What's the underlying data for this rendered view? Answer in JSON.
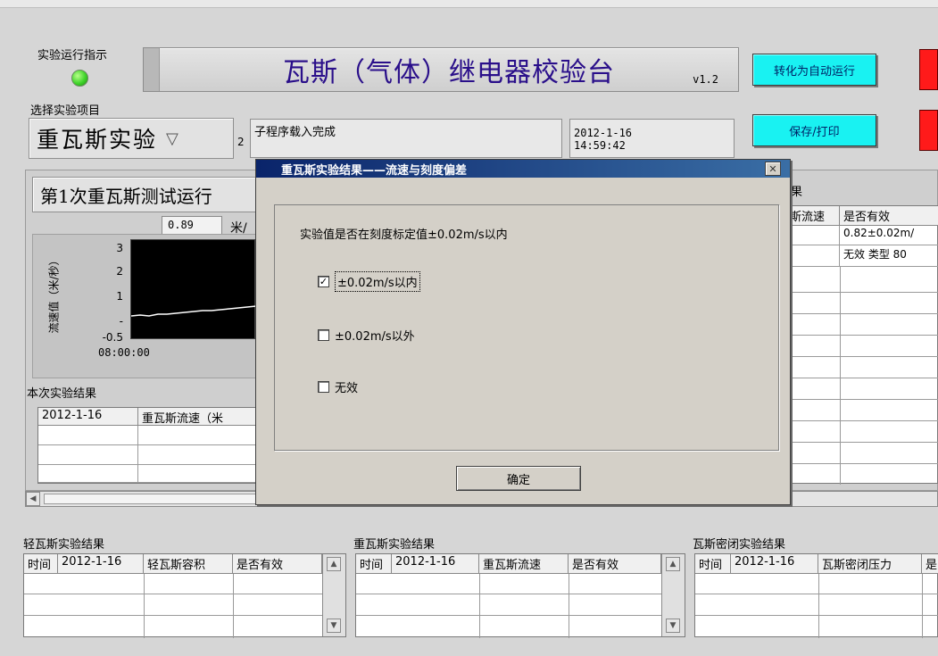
{
  "header": {
    "indicator_label": "实验运行指示",
    "title": "瓦斯（气体）继电器校验台",
    "version": "v1.2",
    "auto_button": "转化为自动运行",
    "save_button": "保存/打印",
    "status_text": "子程序载入完成",
    "date": "2012-1-16",
    "time": "14:59:42",
    "led_color": "#3fd42a",
    "accent_cyan": "#19f2f2",
    "accent_red": "#ff1a1a"
  },
  "selector": {
    "label": "选择实验项目",
    "value": "重瓦斯实验",
    "partial_char": "2"
  },
  "left_panel": {
    "test_title": "第1次重瓦斯测试运行",
    "speed_value": "0.89",
    "speed_unit": "米/",
    "ylabel": "流速值（米/秒）",
    "yticks": [
      "3",
      "2",
      "1",
      "-",
      "-0.5"
    ],
    "xtick": "08:00:00",
    "result_label": "本次实验结果",
    "result_headers": [
      "2012-1-16",
      "重瓦斯流速（米"
    ]
  },
  "right_panel": {
    "partial_label": "果",
    "headers": [
      "斯流速",
      "是否有效"
    ],
    "rows": [
      [
        "",
        "0.82±0.02m/"
      ],
      [
        "",
        "无效 类型 80"
      ]
    ]
  },
  "dialog": {
    "title": "重瓦斯实验结果——流速与刻度偏差",
    "question": "实验值是否在刻度标定值±0.02m/s以内",
    "options": [
      {
        "label": "±0.02m/s以内",
        "checked": true
      },
      {
        "label": "±0.02m/s以外",
        "checked": false
      },
      {
        "label": "无效",
        "checked": false
      }
    ],
    "ok_button": "确定",
    "close_glyph": "✕",
    "check_glyph": "✓"
  },
  "bottom": {
    "light": {
      "label": "轻瓦斯实验结果",
      "headers": [
        "时间",
        "2012-1-16",
        "轻瓦斯容积",
        "是否有效"
      ]
    },
    "heavy": {
      "label": "重瓦斯实验结果",
      "headers": [
        "时间",
        "2012-1-16",
        "重瓦斯流速",
        "是否有效"
      ]
    },
    "seal": {
      "label": "瓦斯密闭实验结果",
      "headers": [
        "时间",
        "2012-1-16",
        "瓦斯密闭压力",
        "是"
      ]
    }
  }
}
